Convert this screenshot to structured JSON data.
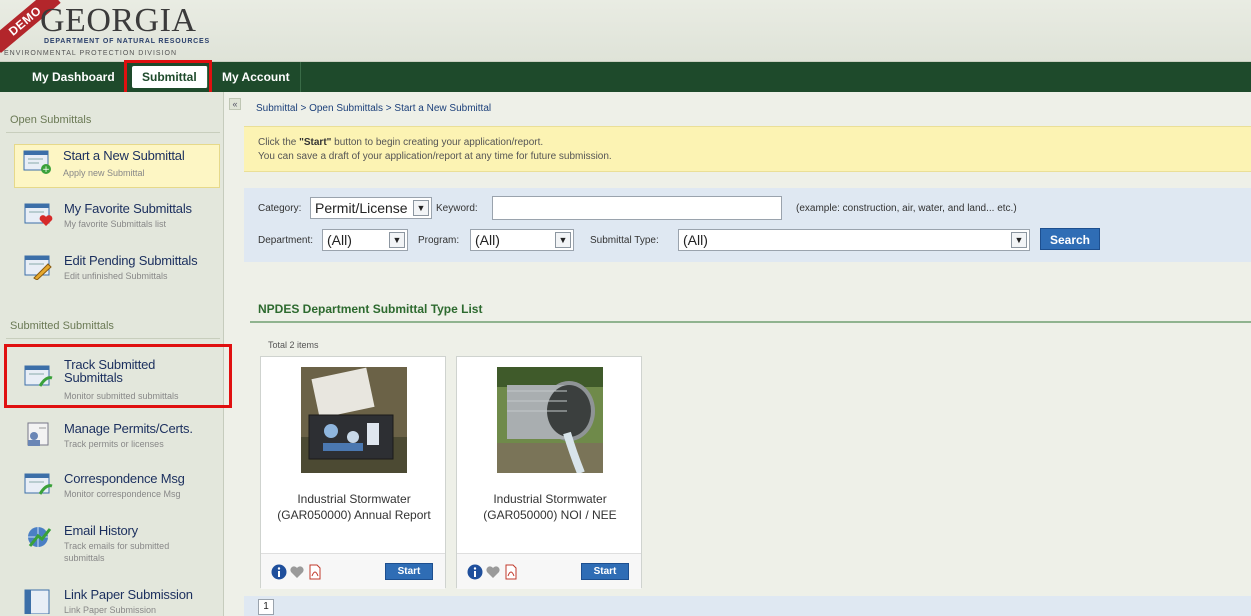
{
  "header": {
    "demo_ribbon": "DEMO",
    "logo_title": "GEORGIA",
    "logo_sub1": "DEPARTMENT OF NATURAL RESOURCES",
    "logo_sub2": "ENVIRONMENTAL PROTECTION DIVISION"
  },
  "nav": {
    "tabs": [
      {
        "label": "My Dashboard"
      },
      {
        "label": "Submittal"
      },
      {
        "label": "My Account"
      }
    ],
    "active": "Submittal"
  },
  "sidebar": {
    "section1": "Open Submittals",
    "section2": "Submitted Submittals",
    "items": [
      {
        "title": "Start a New Submittal",
        "sub": "Apply new Submittal",
        "icon": "new-submittal-icon"
      },
      {
        "title": "My Favorite Submittals",
        "sub": "My favorite Submittals list",
        "icon": "favorite-submittals-icon"
      },
      {
        "title": "Edit Pending Submittals",
        "sub": "Edit unfinished Submittals",
        "icon": "edit-pending-icon"
      },
      {
        "title": "Track Submitted",
        "title2": "Submittals",
        "sub": "Monitor submitted submittals",
        "icon": "track-submitted-icon"
      },
      {
        "title": "Manage Permits/Certs.",
        "sub": "Track permits or licenses",
        "icon": "manage-permits-icon"
      },
      {
        "title": "Correspondence Msg",
        "sub": "Monitor correspondence Msg",
        "icon": "correspondence-icon"
      },
      {
        "title": "Email History",
        "sub": "Track emails for submitted",
        "sub2": "submittals",
        "icon": "email-history-icon"
      },
      {
        "title": "Link Paper Submission",
        "sub": "Link Paper Submission",
        "icon": "link-paper-icon"
      }
    ]
  },
  "breadcrumb": "Submittal > Open Submittals > Start a New Submittal",
  "info": {
    "line1_pre": "Click the ",
    "line1_bold": "\"Start\"",
    "line1_post": " button to begin creating your application/report.",
    "line2": "You can save a draft of your application/report at any time for future submission."
  },
  "search": {
    "category_label": "Category:",
    "category_value": "Permit/License",
    "keyword_label": "Keyword:",
    "keyword_value": "",
    "keyword_hint": "(example: construction, air, water, and land... etc.)",
    "department_label": "Department:",
    "department_value": "(All)",
    "program_label": "Program:",
    "program_value": "(All)",
    "type_label": "Submittal Type:",
    "type_value": "(All)",
    "button": "Search"
  },
  "list": {
    "title": "NPDES Department Submittal Type List",
    "total": "Total 2 items",
    "cards": [
      {
        "line1": "Industrial Stormwater",
        "line2": "(GAR050000) Annual Report",
        "start": "Start"
      },
      {
        "line1": "Industrial Stormwater",
        "line2": "(GAR050000) NOI / NEE",
        "start": "Start"
      }
    ]
  },
  "pager": {
    "page": "1"
  },
  "colors": {
    "nav_bg": "#1e4a2b",
    "highlight": "#e01010",
    "button": "#2f6db5"
  }
}
